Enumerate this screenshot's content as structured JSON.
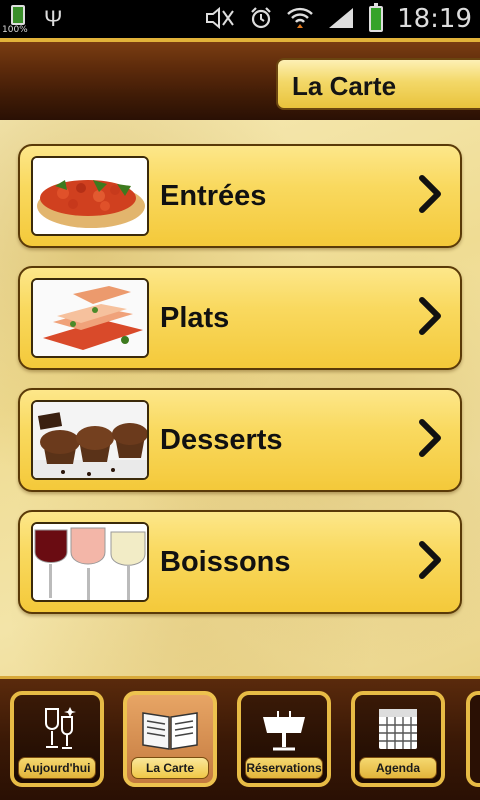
{
  "status_bar": {
    "battery_left_percent": "100%",
    "time": "18:19",
    "icons": [
      "usb-icon",
      "mute-icon",
      "alarm-icon",
      "wifi-icon",
      "signal-icon",
      "battery-icon"
    ]
  },
  "header": {
    "title": "La Carte"
  },
  "menu": {
    "items": [
      {
        "label": "Entrées",
        "thumbnail": "bruschetta-image"
      },
      {
        "label": "Plats",
        "thumbnail": "salmon-dish-image"
      },
      {
        "label": "Desserts",
        "thumbnail": "muffins-image"
      },
      {
        "label": "Boissons",
        "thumbnail": "wine-glasses-image"
      }
    ]
  },
  "tabs": {
    "items": [
      {
        "label": "Aujourd'hui",
        "icon": "champagne-icon",
        "active": false
      },
      {
        "label": "La Carte",
        "icon": "menu-book-icon",
        "active": true
      },
      {
        "label": "Réservations",
        "icon": "table-icon",
        "active": false
      },
      {
        "label": "Agenda",
        "icon": "calendar-icon",
        "active": false
      }
    ]
  },
  "colors": {
    "header_brown": "#5c2a0b",
    "gold_accent": "#e7bb45",
    "button_yellow": "#f9d95f",
    "active_tab": "#c47a3f"
  }
}
